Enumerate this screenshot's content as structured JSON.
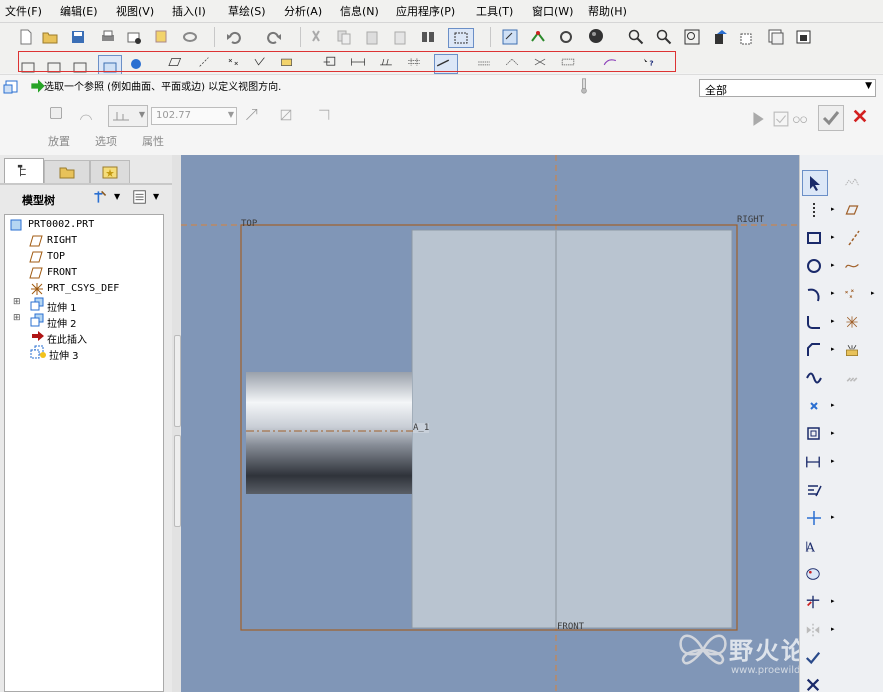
{
  "menu": [
    "文件(F)",
    "编辑(E)",
    "视图(V)",
    "插入(I)",
    "草绘(S)",
    "分析(A)",
    "信息(N)",
    "应用程序(P)",
    "工具(T)",
    "窗口(W)",
    "帮助(H)"
  ],
  "status": {
    "prompt": "选取一个参照 (例如曲面、平面或边) 以定义视图方向.",
    "filter": "全部"
  },
  "dashboard": {
    "value": "102.77",
    "tabs": [
      "放置",
      "选项",
      "属性"
    ]
  },
  "model_tree": {
    "title": "模型树",
    "items": [
      {
        "label": "PRT0002.PRT",
        "icon": "part-icon"
      },
      {
        "label": "RIGHT",
        "icon": "datum-plane-icon"
      },
      {
        "label": "TOP",
        "icon": "datum-plane-icon"
      },
      {
        "label": "FRONT",
        "icon": "datum-plane-icon"
      },
      {
        "label": "PRT_CSYS_DEF",
        "icon": "csys-icon"
      },
      {
        "label": "拉伸 1",
        "icon": "extrude-icon"
      },
      {
        "label": "拉伸 2",
        "icon": "extrude-icon"
      },
      {
        "label": "在此插入",
        "icon": "insert-here-arrow-icon"
      },
      {
        "label": "拉伸 3",
        "icon": "extrude-icon"
      }
    ]
  },
  "canvas": {
    "labels": {
      "top": "TOP",
      "right": "RIGHT",
      "front": "FRONT",
      "axis": "A_1"
    }
  },
  "watermark": {
    "title": "野火论坛",
    "url": "www.proewildfire.cn"
  },
  "colors": {
    "canvas_bg": "#8096b7",
    "datum": "#d9823a",
    "accept": "#2e8b2e",
    "cancel": "#d32020",
    "highlight_box": "#dd3333"
  }
}
